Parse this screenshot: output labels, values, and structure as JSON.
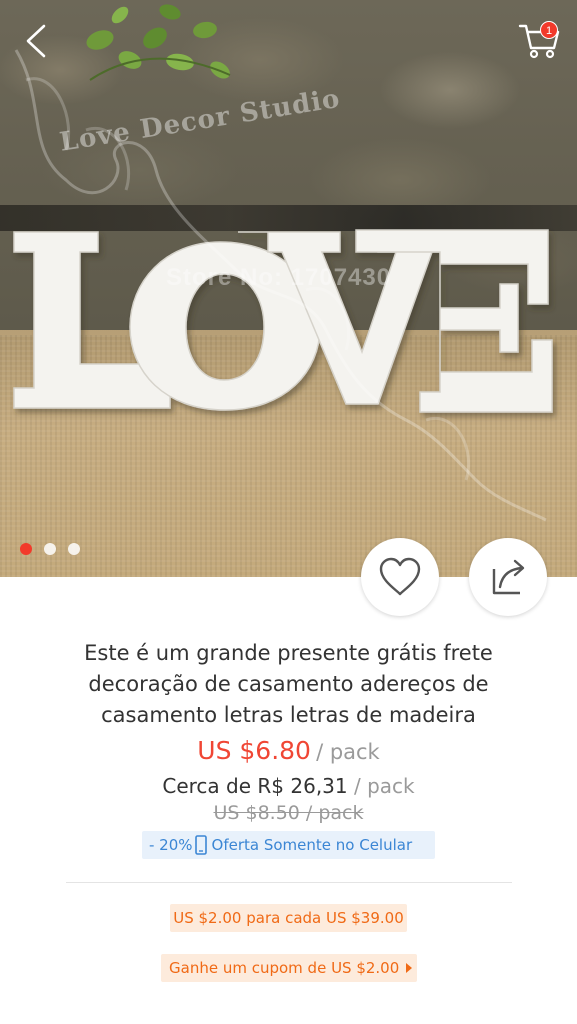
{
  "hero": {
    "watermark_store": "Love Decor Studio",
    "watermark_store_no": "Store No: 1707430",
    "image_text": "LOVE",
    "carousel_count": 3,
    "carousel_active_index": 0
  },
  "header": {
    "back_icon": "chevron-left-icon",
    "cart_icon": "shopping-cart-icon",
    "cart_count": "1"
  },
  "actions": {
    "wishlist_icon": "heart-icon",
    "share_icon": "share-icon"
  },
  "product": {
    "title": "Este é um grande presente grátis frete decoração de casamento adereços de casamento letras letras de madeira",
    "price": "US $6.80",
    "price_unit": "/ pack",
    "approx_price": "Cerca de R$ 26,31",
    "approx_unit": "/ pack",
    "original_price": "US $8.50  / pack"
  },
  "offers": {
    "mobile_discount": "- 20%",
    "mobile_label": "Oferta Somente no Celular",
    "discount_promo": "US $2.00 para cada US $39.00",
    "coupon_promo": "Ganhe um cupom de US $2.00"
  },
  "colors": {
    "accent_red": "#f04634",
    "mobile_blue": "#3b86d4",
    "promo_orange": "#f06a16"
  }
}
